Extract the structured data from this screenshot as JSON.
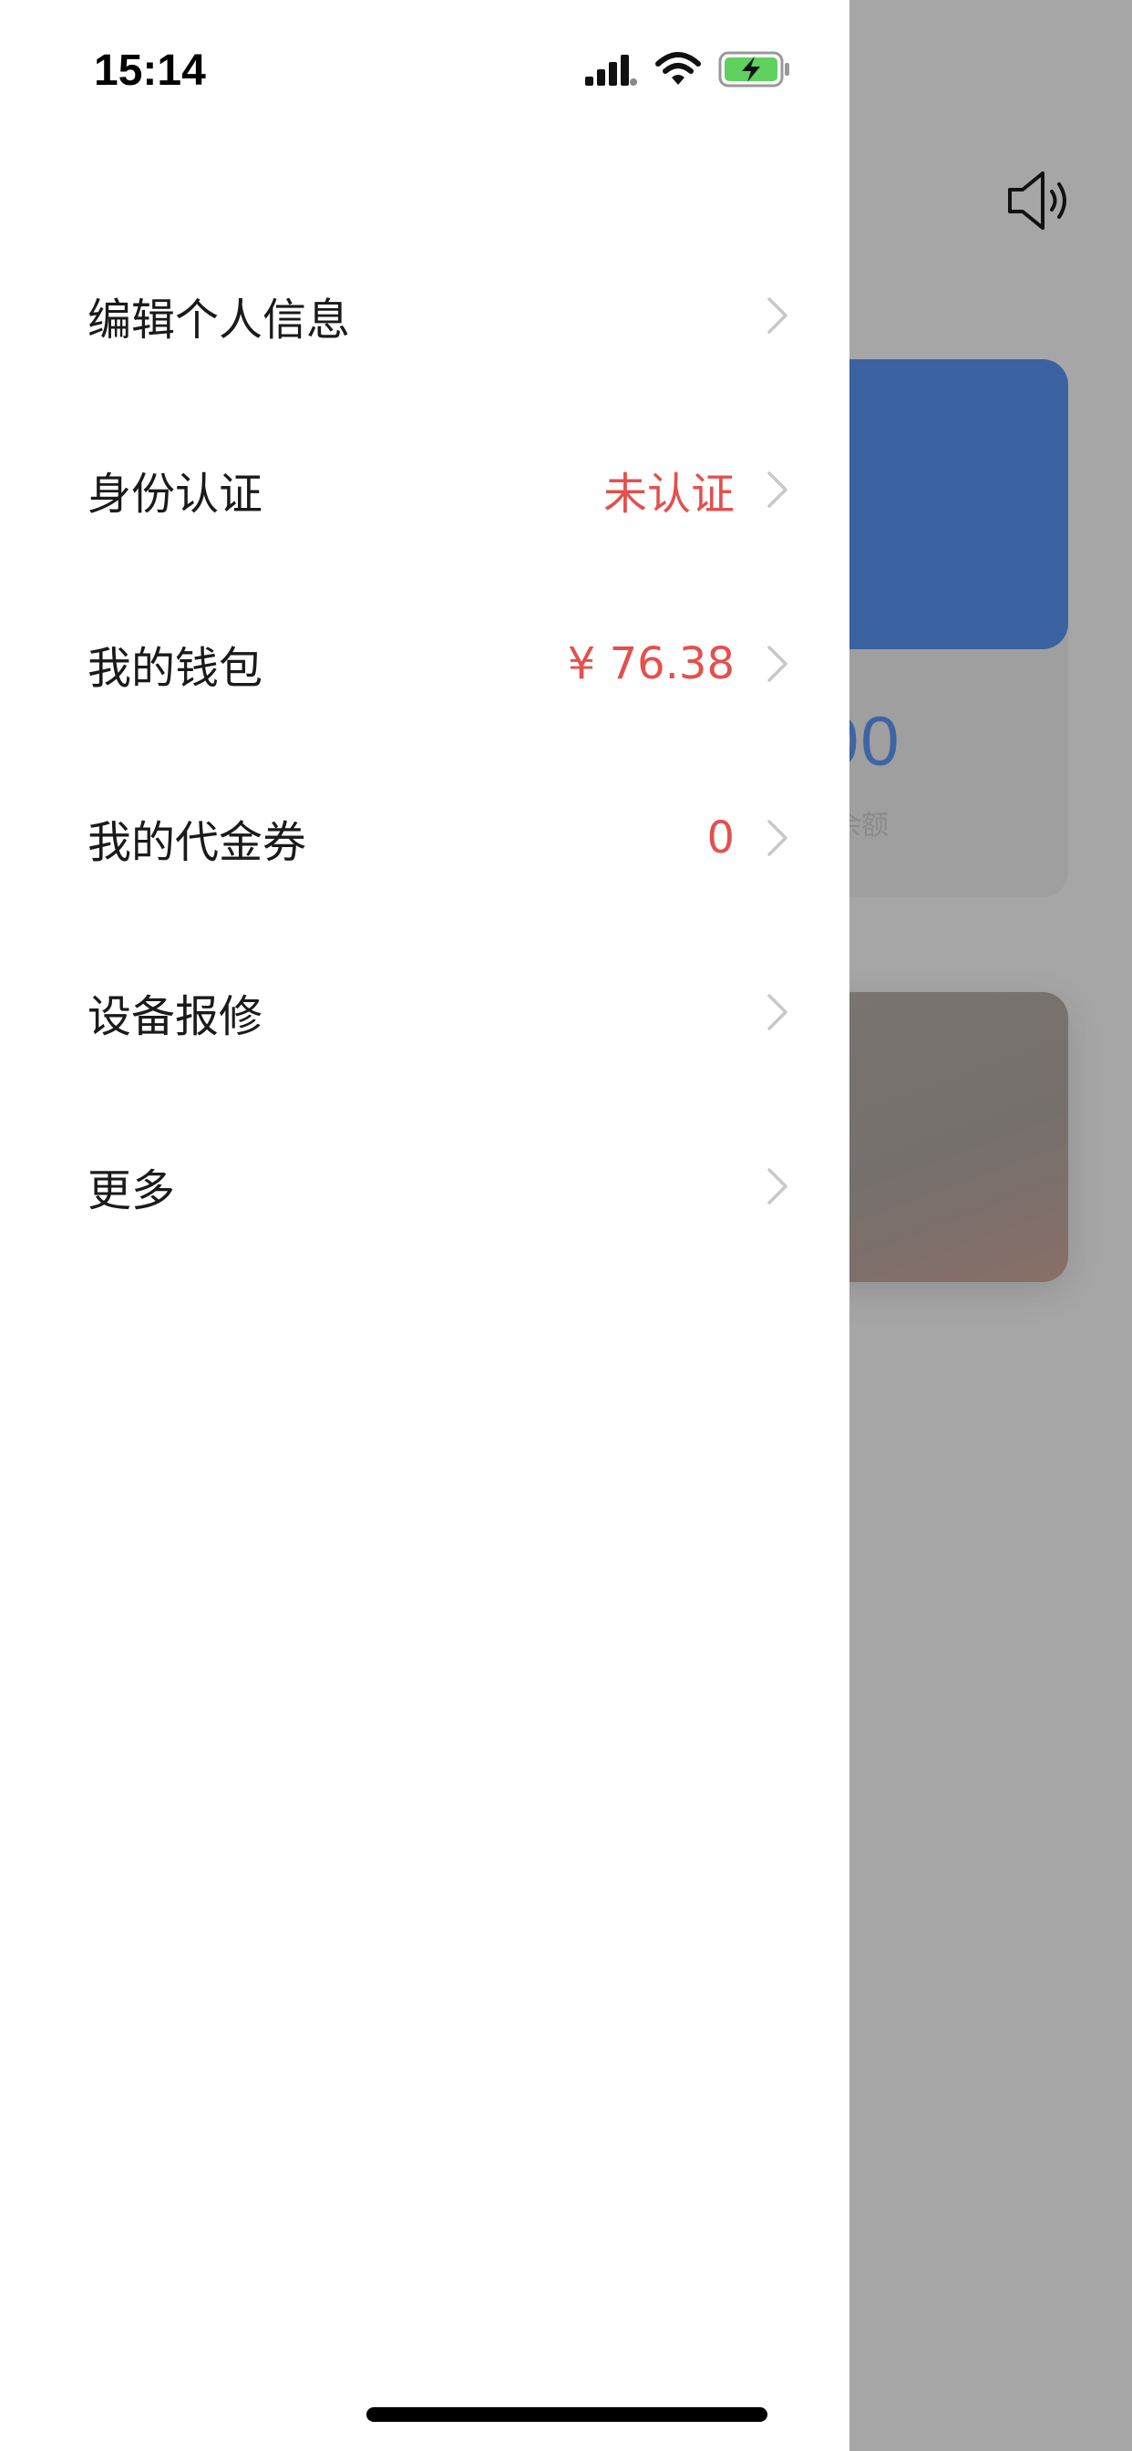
{
  "status_bar": {
    "time": "15:14"
  },
  "menu": {
    "items": [
      {
        "label": "编辑个人信息",
        "value": ""
      },
      {
        "label": "身份认证",
        "value": "未认证"
      },
      {
        "label": "我的钱包",
        "value": "¥ 76.38"
      },
      {
        "label": "我的代金券",
        "value": "0"
      },
      {
        "label": "设备报修",
        "value": ""
      },
      {
        "label": "更多",
        "value": ""
      }
    ]
  },
  "background_app": {
    "balance_amount_partial": "00",
    "balance_label_partial": "余额"
  },
  "colors": {
    "accent_red": "#e4504c",
    "card_blue": "#3b62a0",
    "overlay_gray": "#a6a6a6",
    "battery_green": "#5ed15e"
  },
  "icons": [
    "speaker-icon",
    "signal-icon",
    "wifi-icon",
    "battery-charging-icon",
    "chevron-right-icon"
  ]
}
